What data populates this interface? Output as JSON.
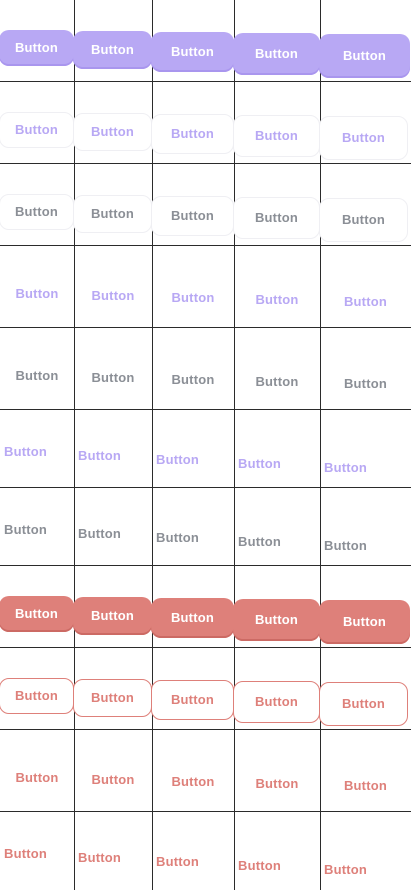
{
  "colors": {
    "primary": "#b8a8f4",
    "primary_border": "#a996ee",
    "neutral": "#8b8f96",
    "danger": "#de807a",
    "danger_border": "#cc6a64",
    "divider": "#2b2b2b",
    "faint_border": "#efeff3"
  },
  "button_label": "Button",
  "rows": [
    {
      "variant": "filled",
      "tone": "primary",
      "labels": [
        "Button",
        "Button",
        "Button",
        "Button",
        "Button"
      ]
    },
    {
      "variant": "outline",
      "tone": "primary",
      "labels": [
        "Button",
        "Button",
        "Button",
        "Button",
        "Button"
      ]
    },
    {
      "variant": "outline",
      "tone": "neutral",
      "labels": [
        "Button",
        "Button",
        "Button",
        "Button",
        "Button"
      ]
    },
    {
      "variant": "ghost",
      "tone": "primary",
      "labels": [
        "Button",
        "Button",
        "Button",
        "Button",
        "Button"
      ]
    },
    {
      "variant": "ghost",
      "tone": "neutral",
      "labels": [
        "Button",
        "Button",
        "Button",
        "Button",
        "Button"
      ]
    },
    {
      "variant": "text",
      "tone": "primary",
      "labels": [
        "Button",
        "Button",
        "Button",
        "Button",
        "Button"
      ]
    },
    {
      "variant": "text",
      "tone": "neutral",
      "labels": [
        "Button",
        "Button",
        "Button",
        "Button",
        "Button"
      ]
    },
    {
      "variant": "filled",
      "tone": "danger",
      "labels": [
        "Button",
        "Button",
        "Button",
        "Button",
        "Button"
      ]
    },
    {
      "variant": "outline",
      "tone": "danger",
      "labels": [
        "Button",
        "Button",
        "Button",
        "Button",
        "Button"
      ]
    },
    {
      "variant": "ghost",
      "tone": "danger",
      "labels": [
        "Button",
        "Button",
        "Button",
        "Button",
        "Button"
      ]
    },
    {
      "variant": "text",
      "tone": "danger",
      "labels": [
        "Button",
        "Button",
        "Button",
        "Button",
        "Button"
      ]
    }
  ]
}
